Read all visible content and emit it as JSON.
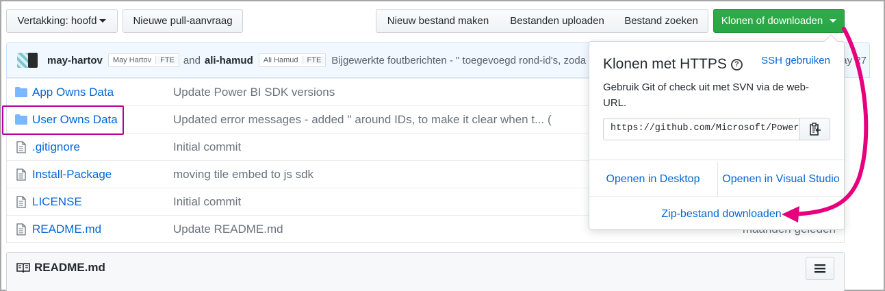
{
  "toolbar": {
    "branch_label": "Vertakking: hoofd",
    "new_pr": "Nieuwe pull-aanvraag",
    "new_file": "Nieuw bestand maken",
    "upload": "Bestanden uploaden",
    "find": "Bestand zoeken",
    "clone": "Klonen of downloaden"
  },
  "commit": {
    "author1": "may-hartov",
    "author1_full": "May Hartov",
    "author1_badge": "FTE",
    "and": "and",
    "author2": "ali-hamud",
    "author2_full": "Ali Hamud",
    "author2_badge": "FTE",
    "message": "Bijgewerkte foutberichten - \" toegevoegd rond-id's, zoda",
    "date": "ay 27"
  },
  "files": [
    {
      "type": "folder",
      "name": "App Owns Data",
      "message": "Update Power BI SDK versions",
      "date": ""
    },
    {
      "type": "folder",
      "name": "User Owns Data",
      "message": "Updated error messages - added '' around IDs, to make it clear when t... (",
      "date": ""
    },
    {
      "type": "file",
      "name": ".gitignore",
      "message": "Initial commit",
      "date": ""
    },
    {
      "type": "file",
      "name": "Install-Package",
      "message": "moving tile embed to js sdk",
      "date": ""
    },
    {
      "type": "file",
      "name": "LICENSE",
      "message": "Initial commit",
      "date": ""
    },
    {
      "type": "file",
      "name": "README.md",
      "message": "Update README.md",
      "date": "maanden geleden"
    }
  ],
  "readme": {
    "title": "README.md"
  },
  "clone_dropdown": {
    "title": "Klonen met HTTPS",
    "help": "?",
    "ssh_link": "SSH gebruiken",
    "description": "Gebruik Git of check uit met SVN via de web-URL.",
    "url": "https://github.com/Microsoft/PowerBI-Developer-Samples.git",
    "open_desktop": "Openen in Desktop",
    "open_vs": "Openen in Visual Studio",
    "zip": "Zip-bestand downloaden"
  },
  "colors": {
    "accent_green": "#28a745",
    "link_blue": "#0366d6",
    "annotation_magenta": "#e6007e",
    "highlight_purple": "#b4009e"
  }
}
